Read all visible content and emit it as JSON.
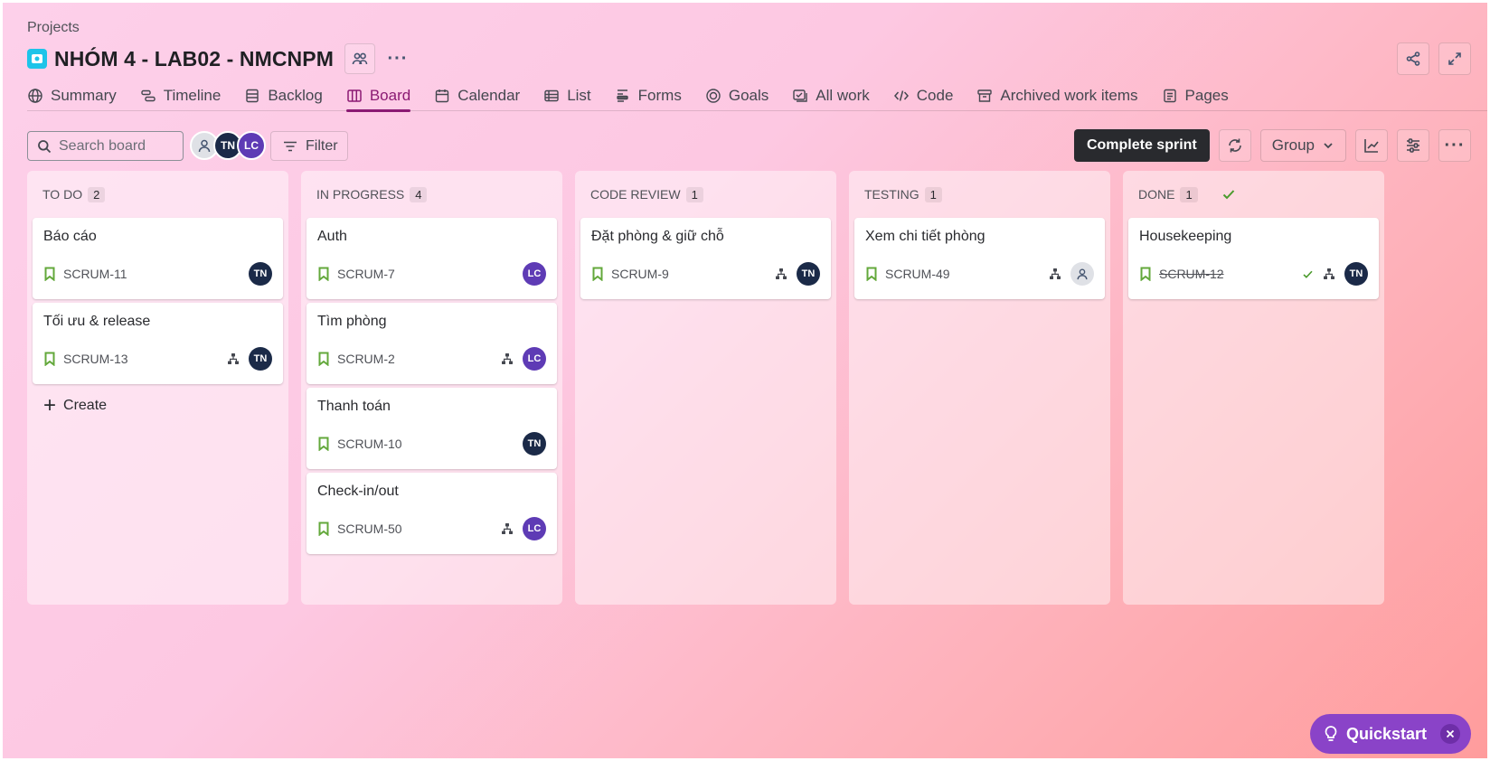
{
  "breadcrumb": "Projects",
  "project": {
    "title": "NHÓM 4 - LAB02 - NMCNPM"
  },
  "tabs": [
    {
      "label": "Summary",
      "icon": "globe-icon"
    },
    {
      "label": "Timeline",
      "icon": "timeline-icon"
    },
    {
      "label": "Backlog",
      "icon": "backlog-icon"
    },
    {
      "label": "Board",
      "icon": "board-icon",
      "active": true
    },
    {
      "label": "Calendar",
      "icon": "calendar-icon"
    },
    {
      "label": "List",
      "icon": "list-icon"
    },
    {
      "label": "Forms",
      "icon": "forms-icon"
    },
    {
      "label": "Goals",
      "icon": "goals-icon"
    },
    {
      "label": "All work",
      "icon": "all-work-icon"
    },
    {
      "label": "Code",
      "icon": "code-icon"
    },
    {
      "label": "Archived work items",
      "icon": "archive-icon"
    },
    {
      "label": "Pages",
      "icon": "pages-icon"
    }
  ],
  "toolbar": {
    "search_placeholder": "Search board",
    "filter_label": "Filter",
    "complete_label": "Complete sprint",
    "group_label": "Group",
    "avatars": [
      "",
      "TN",
      "LC"
    ]
  },
  "columns": [
    {
      "name": "TO DO",
      "count": "2",
      "cards": [
        {
          "title": "Báo cáo",
          "key": "SCRUM-11",
          "assignee": "TN"
        },
        {
          "title": "Tối ưu & release",
          "key": "SCRUM-13",
          "assignee": "TN",
          "subtasks": true
        }
      ],
      "create_label": "Create"
    },
    {
      "name": "IN PROGRESS",
      "count": "4",
      "cards": [
        {
          "title": "Auth",
          "key": "SCRUM-7",
          "assignee": "LC"
        },
        {
          "title": "Tìm phòng",
          "key": "SCRUM-2",
          "assignee": "LC",
          "subtasks": true
        },
        {
          "title": "Thanh toán",
          "key": "SCRUM-10",
          "assignee": "TN"
        },
        {
          "title": "Check-in/out",
          "key": "SCRUM-50",
          "assignee": "LC",
          "subtasks": true
        }
      ]
    },
    {
      "name": "CODE REVIEW",
      "count": "1",
      "cards": [
        {
          "title": "Đặt phòng & giữ chỗ",
          "key": "SCRUM-9",
          "assignee": "TN",
          "subtasks": true
        }
      ]
    },
    {
      "name": "TESTING",
      "count": "1",
      "cards": [
        {
          "title": "Xem chi tiết phòng",
          "key": "SCRUM-49",
          "assignee": "",
          "subtasks": true
        }
      ]
    },
    {
      "name": "DONE",
      "count": "1",
      "done": true,
      "cards": [
        {
          "title": "Housekeeping",
          "key": "SCRUM-12",
          "assignee": "TN",
          "subtasks": true,
          "done": true
        }
      ]
    }
  ],
  "quickstart": {
    "label": "Quickstart"
  },
  "colors": {
    "accent": "#8b1a73",
    "story": "#63a83b",
    "avatar_tn": "#1b2a48",
    "avatar_lc": "#5e3bb5",
    "quickstart": "#8a43c8",
    "done_check": "#4a9a2c"
  }
}
